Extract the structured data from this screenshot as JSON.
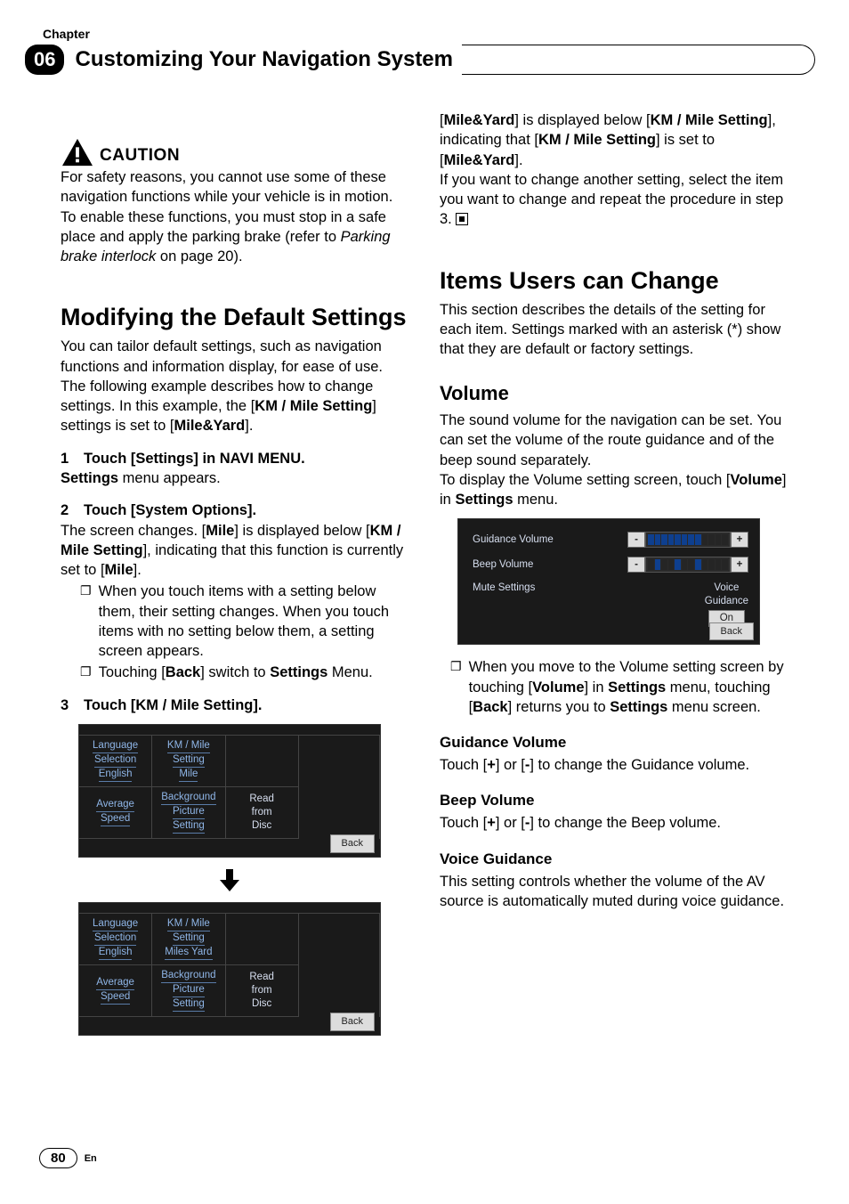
{
  "chapter": {
    "label": "Chapter",
    "number": "06",
    "title": "Customizing Your Navigation System"
  },
  "caution": {
    "word": "CAUTION",
    "text": "For safety reasons, you cannot use some of these navigation functions while your vehicle is in motion. To enable these functions, you must stop in a safe place and apply the parking brake (refer to ",
    "italic": "Parking brake interlock",
    "text2": " on page 20)."
  },
  "section1": {
    "title": "Modifying the Default Settings",
    "p1": "You can tailor default settings, such as navigation functions and information display, for ease of use.",
    "p2a": "The following example describes how to change settings. In this example, the [",
    "p2b": "KM / Mile Setting",
    "p2c": "] settings is set to [",
    "p2d": "Mile&Yard",
    "p2e": "].",
    "step1": {
      "num": "1",
      "title": "Touch [Settings] in NAVI MENU.",
      "body_a": "Settings",
      "body_b": " menu appears."
    },
    "step2": {
      "num": "2",
      "title": "Touch [System Options].",
      "body_a": "The screen changes. [",
      "body_b": "Mile",
      "body_c": "] is displayed below [",
      "body_d": "KM / Mile Setting",
      "body_e": "], indicating that this function is currently set to [",
      "body_f": "Mile",
      "body_g": "].",
      "bullet1": "When you touch items with a setting below them, their setting changes. When you touch items with no setting below them, a setting screen appears.",
      "bullet2_a": "Touching [",
      "bullet2_b": "Back",
      "bullet2_c": "] switch to ",
      "bullet2_d": "Settings",
      "bullet2_e": " Menu."
    },
    "step3": {
      "num": "3",
      "title": "Touch [KM / Mile Setting]."
    }
  },
  "shot1": {
    "lang_a": "Language",
    "lang_b": "Selection",
    "lang_c": "English",
    "km_a": "KM / Mile",
    "km_b": "Setting",
    "km_c": "Mile",
    "avg_a": "Average",
    "avg_b": "Speed",
    "bg_a": "Background",
    "bg_b": "Picture",
    "bg_c": "Setting",
    "rd_a": "Read",
    "rd_b": "from",
    "rd_c": "Disc",
    "back": "Back"
  },
  "shot2": {
    "lang_a": "Language",
    "lang_b": "Selection",
    "lang_c": "English",
    "km_a": "KM / Mile",
    "km_b": "Setting",
    "km_c": "Miles Yard",
    "avg_a": "Average",
    "avg_b": "Speed",
    "bg_a": "Background",
    "bg_b": "Picture",
    "bg_c": "Setting",
    "rd_a": "Read",
    "rd_b": "from",
    "rd_c": "Disc",
    "back": "Back"
  },
  "right_top": {
    "a": "[",
    "b": "Mile&Yard",
    "c": "] is displayed below [",
    "d": "KM / Mile Setting",
    "e": "], indicating that [",
    "f": "KM / Mile Setting",
    "g": "] is set to [",
    "h": "Mile&Yard",
    "i": "].",
    "p2": "If you want to change another setting, select the item you want to change and repeat the procedure in step 3."
  },
  "section2": {
    "title": "Items Users can Change",
    "intro": "This section describes the details of the setting for each item. Settings marked with an asterisk (*) show that they are default or factory settings."
  },
  "volume": {
    "title": "Volume",
    "p1": "The sound volume for the navigation can be set. You can set the volume of the route guidance and of the beep sound separately.",
    "p2a": "To display the Volume setting screen, touch [",
    "p2b": "Volume",
    "p2c": "] in ",
    "p2d": "Settings",
    "p2e": " menu.",
    "shot": {
      "gv": "Guidance Volume",
      "bv": "Beep Volume",
      "ms": "Mute Settings",
      "voice": "Voice",
      "guidance": "Guidance",
      "on": "On",
      "minus": "-",
      "plus": "+",
      "back": "Back"
    },
    "bullet_a": "When you move to the Volume setting screen by touching [",
    "bullet_b": "Volume",
    "bullet_c": "] in ",
    "bullet_d": "Settings",
    "bullet_e": " menu, touching [",
    "bullet_f": "Back",
    "bullet_g": "] returns you to ",
    "bullet_h": "Settings",
    "bullet_i": " menu screen.",
    "gv": {
      "title": "Guidance Volume",
      "body_a": "Touch [",
      "body_b": "+",
      "body_c": "] or [",
      "body_d": "-",
      "body_e": "] to change the Guidance volume."
    },
    "bv": {
      "title": "Beep Volume",
      "body_a": "Touch [",
      "body_b": "+",
      "body_c": "] or [",
      "body_d": "-",
      "body_e": "] to change the Beep volume."
    },
    "vg": {
      "title": "Voice Guidance",
      "body": "This setting controls whether the volume of the AV source is automatically muted during voice guidance."
    }
  },
  "footer": {
    "page": "80",
    "lang": "En"
  }
}
